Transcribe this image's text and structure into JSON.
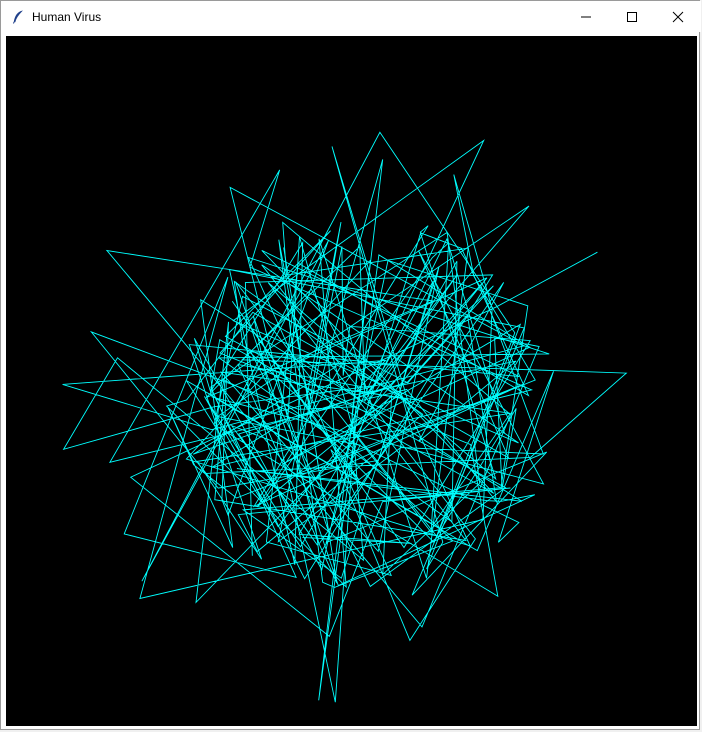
{
  "window": {
    "title": "Human Virus",
    "controls": {
      "minimize_icon": "minimize-icon",
      "maximize_icon": "maximize-icon",
      "close_icon": "close-icon"
    }
  },
  "canvas": {
    "background": "#000000",
    "stroke_color": "#00ffff"
  }
}
